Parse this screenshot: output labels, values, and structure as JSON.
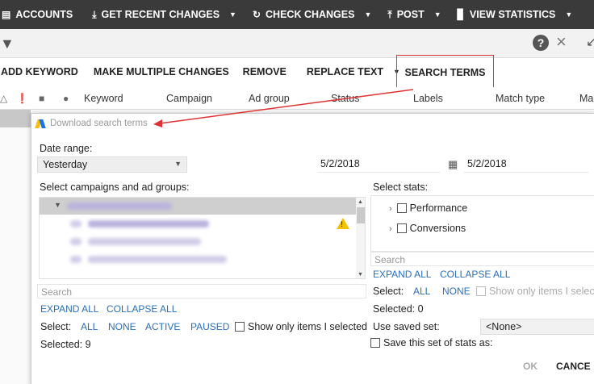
{
  "toolbar": {
    "accounts": "ACCOUNTS",
    "get_recent_changes": "GET RECENT CHANGES",
    "check_changes": "CHECK CHANGES",
    "post": "POST",
    "view_statistics": "VIEW STATISTICS"
  },
  "actions": {
    "add_keyword": "ADD KEYWORD",
    "make_multiple_changes": "MAKE MULTIPLE CHANGES",
    "remove": "REMOVE",
    "replace_text": "REPLACE TEXT",
    "search_terms": "SEARCH TERMS"
  },
  "columns": {
    "keyword": "Keyword",
    "campaign": "Campaign",
    "ad_group": "Ad group",
    "status": "Status",
    "labels": "Labels",
    "match_type": "Match type",
    "max_cpc": "Ma"
  },
  "dialog": {
    "title": "Download search terms",
    "date_range_label": "Date range:",
    "date_range_value": "Yesterday",
    "date_from": "5/2/2018",
    "date_to": "5/2/2018",
    "campaigns_label": "Select campaigns and ad groups:",
    "search_placeholder": "Search",
    "expand_all": "EXPAND ALL",
    "collapse_all": "COLLAPSE ALL",
    "select_label": "Select:",
    "select_all": "ALL",
    "select_none": "NONE",
    "select_active": "ACTIVE",
    "select_paused": "PAUSED",
    "show_only_selected": "Show only items I selected",
    "selected_count": "Selected: 9",
    "stats_label": "Select stats:",
    "stats_items": [
      "Performance",
      "Conversions"
    ],
    "stats_search_placeholder": "Search",
    "stats_expand_all": "EXPAND ALL",
    "stats_collapse_all": "COLLAPSE ALL",
    "stats_select_label": "Select:",
    "stats_all": "ALL",
    "stats_none": "NONE",
    "stats_show_only": "Show only items I select",
    "stats_selected_count": "Selected: 0",
    "use_saved_set_label": "Use saved set:",
    "saved_set_value": "<None>",
    "save_stats_label": "Save this set of stats as:",
    "ok": "OK",
    "cancel": "CANCE"
  },
  "colors": {
    "toolbar_bg": "#3a3a3a",
    "accent_link": "#2a6fb8",
    "highlight_red": "#d33333",
    "warning_yellow": "#f2c200"
  }
}
